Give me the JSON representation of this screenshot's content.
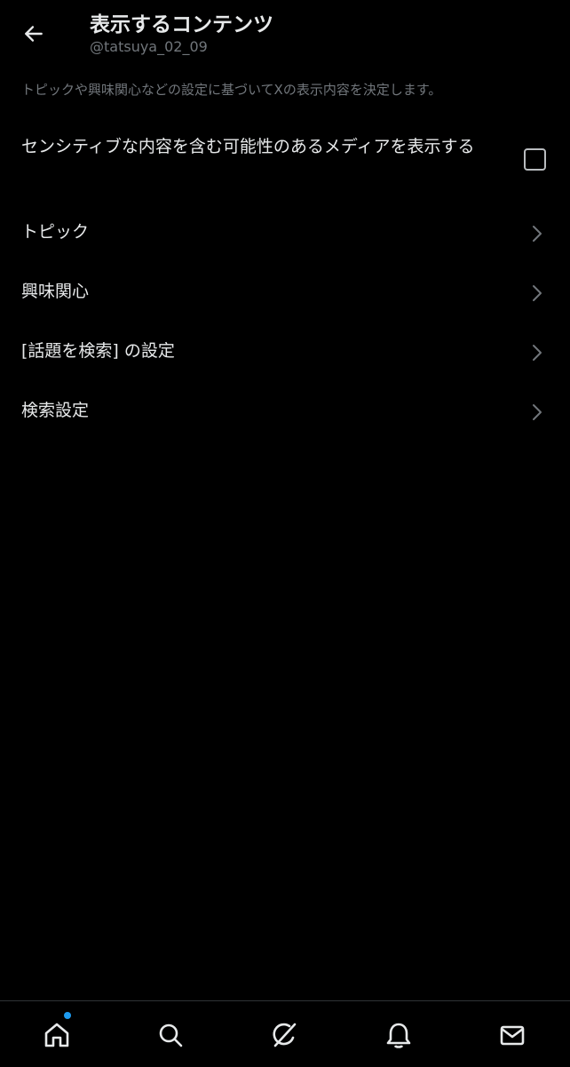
{
  "header": {
    "title": "表示するコンテンツ",
    "handle": "@tatsuya_02_09"
  },
  "description": "トピックや興味関心などの設定に基づいてXの表示内容を決定します。",
  "settings": {
    "sensitive_media": {
      "label": "センシティブな内容を含む可能性のあるメディアを表示する",
      "checked": false
    },
    "items": [
      {
        "label": "トピック"
      },
      {
        "label": "興味関心"
      },
      {
        "label": "[話題を検索] の設定"
      },
      {
        "label": "検索設定"
      }
    ]
  },
  "bottom_nav": {
    "items": [
      "home-icon",
      "search-icon",
      "grok-icon",
      "notifications-icon",
      "messages-icon"
    ],
    "active": "home-icon",
    "unread_dot_color": "#1d9bf0"
  },
  "colors": {
    "background": "#000000",
    "text_primary": "#e7e9ea",
    "text_secondary": "#71767b",
    "accent": "#1d9bf0"
  }
}
